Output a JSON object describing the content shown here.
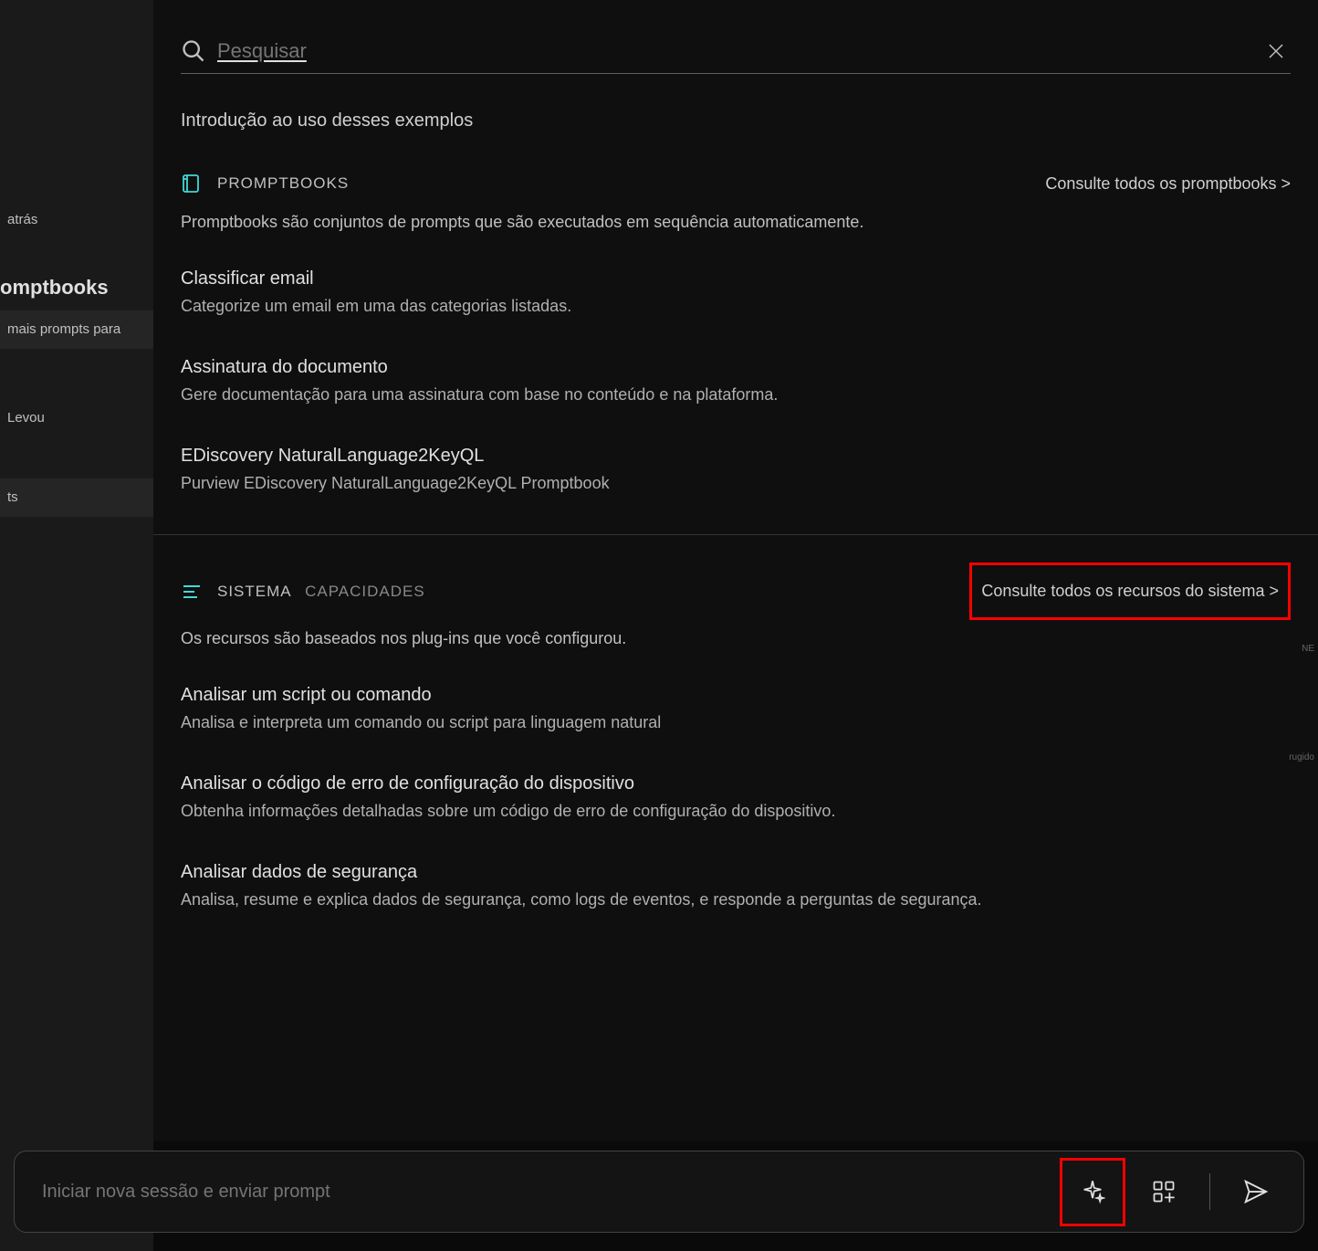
{
  "sidebar": {
    "items": [
      {
        "label": "atrás"
      },
      {
        "label": "omptbooks",
        "section": true
      },
      {
        "label": "mais prompts para",
        "highlight": true
      },
      {
        "label": "Levou"
      },
      {
        "label": "ts",
        "highlight": true
      }
    ]
  },
  "search": {
    "placeholder": "Pesquisar"
  },
  "intro": "Introdução ao uso desses exemplos",
  "promptbooks": {
    "title": "PROMPTBOOKS",
    "see_all": "Consulte todos os promptbooks >",
    "description": "Promptbooks são conjuntos de prompts que são executados em sequência automaticamente.",
    "items": [
      {
        "title": "Classificar email",
        "description": "Categorize um email em uma das categorias listadas."
      },
      {
        "title": "Assinatura do documento",
        "description": "Gere documentação para uma assinatura com base no conteúdo e na plataforma."
      },
      {
        "title": "EDiscovery NaturalLanguage2KeyQL",
        "description": "Purview EDiscovery NaturalLanguage2KeyQL Promptbook"
      }
    ]
  },
  "system": {
    "title": "SISTEMA",
    "title_secondary": "CAPACIDADES",
    "see_all": "Consulte todos os recursos do sistema >",
    "description": "Os recursos são baseados nos plug-ins que você configurou.",
    "items": [
      {
        "title": "Analisar um script ou comando",
        "description": "Analisa e interpreta um comando ou script para linguagem natural"
      },
      {
        "title": "Analisar o código de erro de configuração do dispositivo",
        "description": "Obtenha informações detalhadas sobre um código de erro de configuração do dispositivo."
      },
      {
        "title": "Analisar dados de segurança",
        "description": "Analisa, resume e explica dados de segurança, como logs de eventos, e responde a perguntas de segurança."
      }
    ]
  },
  "bottom_bar": {
    "placeholder": "Iniciar nova sessão e enviar prompt"
  },
  "edge_labels": {
    "ne": "NE",
    "rugido": "rugido"
  }
}
